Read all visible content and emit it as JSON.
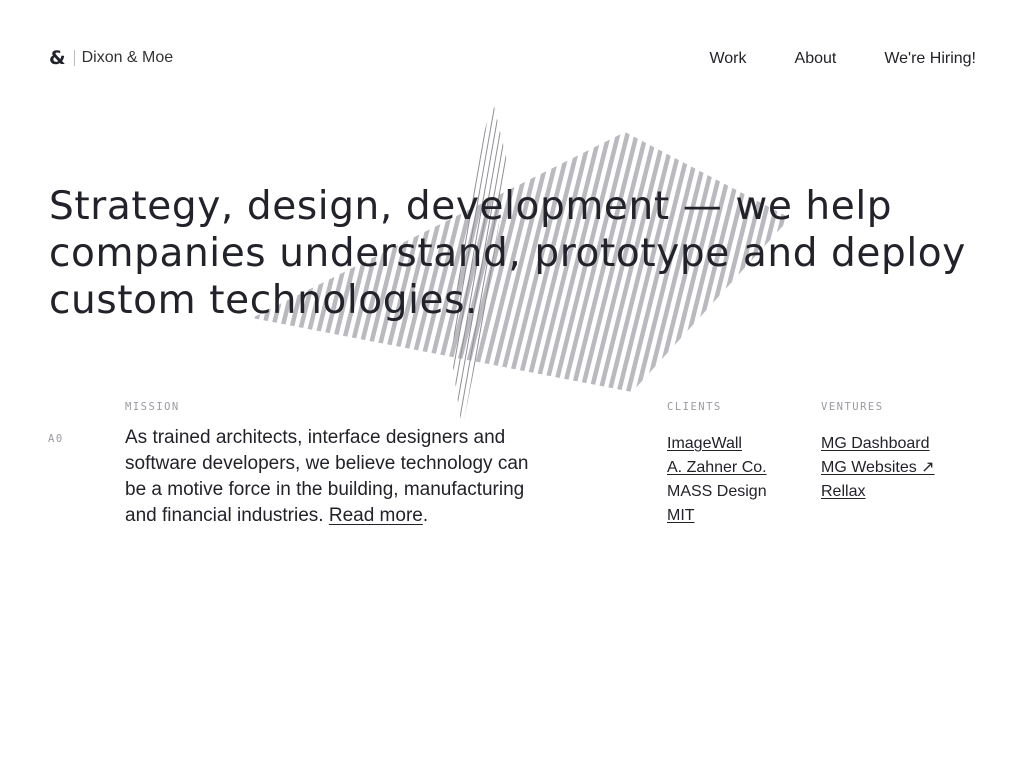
{
  "header": {
    "logo_mark": "&",
    "logo_name": "Dixon & Moe",
    "nav": [
      {
        "label": "Work"
      },
      {
        "label": "About"
      },
      {
        "label": "We're Hiring!"
      }
    ]
  },
  "hero": {
    "headline": "Strategy, design, development — we help companies understand, prototype and deploy custom technologies."
  },
  "section_index": "A0",
  "mission": {
    "label": "MISSION",
    "text": "As trained architects, interface designers and software developers, we believe technology can be a motive force in the building, manufacturing and financial industries. ",
    "link": "Read more",
    "end": "."
  },
  "clients": {
    "label": "CLIENTS",
    "items": [
      {
        "label": "ImageWall",
        "link": true
      },
      {
        "label": "A. Zahner Co.",
        "link": true
      },
      {
        "label": "MASS Design",
        "link": false
      },
      {
        "label": "MIT",
        "link": true
      }
    ]
  },
  "ventures": {
    "label": "VENTURES",
    "items": [
      {
        "label": "MG Dashboard",
        "link": true
      },
      {
        "label": "MG Websites ↗",
        "link": true
      },
      {
        "label": "Rellax",
        "link": true
      }
    ]
  }
}
